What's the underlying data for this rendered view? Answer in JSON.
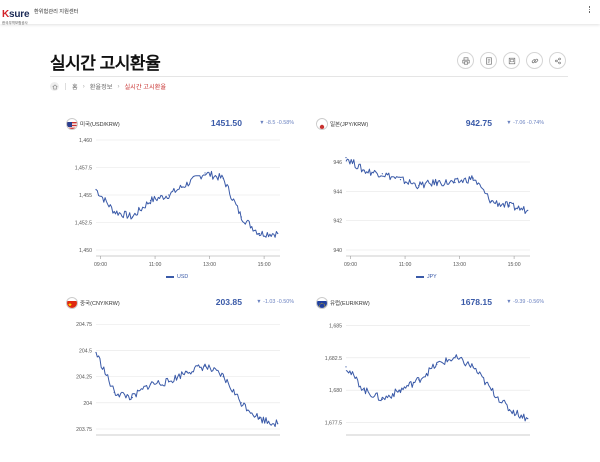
{
  "header": {
    "logo_text": "K sure",
    "logo_sub": "한국무역보험공사",
    "center_name": "환위험관리 지원센터"
  },
  "page": {
    "title": "실시간 고시환율",
    "breadcrumb": [
      "홈",
      "환율정보",
      "실시간 고시환율"
    ]
  },
  "toolbar": [
    "print-icon",
    "document-icon",
    "image-icon",
    "link-icon",
    "share-icon"
  ],
  "colors": {
    "accent": "#3a5aa8",
    "breadcrumb_current": "#c8312f"
  },
  "cards": [
    {
      "name": "미국",
      "code": "USD/KRW",
      "rate": "1451.50",
      "change": "▼ -8.5  -0.58%",
      "legend": "USD",
      "flag": "us"
    },
    {
      "name": "일본",
      "code": "JPY/KRW",
      "rate": "942.75",
      "change": "▼ -7.06  -0.74%",
      "legend": "JPY",
      "flag": "jp"
    },
    {
      "name": "중국",
      "code": "CNY/KRW",
      "rate": "203.85",
      "change": "▼ -1.03  -0.50%",
      "legend": "",
      "flag": "cn"
    },
    {
      "name": "유럽",
      "code": "EUR/KRW",
      "rate": "1678.15",
      "change": "▼ -9.39  -0.56%",
      "legend": "",
      "flag": "eu"
    }
  ],
  "chart_data": [
    {
      "type": "line",
      "series": [
        {
          "name": "USD",
          "x": [
            "08:50",
            "09:30",
            "10:10",
            "10:50",
            "11:30",
            "12:10",
            "12:50",
            "13:30",
            "14:10",
            "14:50",
            "15:30"
          ],
          "values": [
            1455.5,
            1453.5,
            1453.0,
            1454.5,
            1455.0,
            1456.0,
            1457.0,
            1456.5,
            1453.0,
            1451.5,
            1451.5
          ]
        }
      ],
      "yticks": [
        "1,450",
        "1,452.5",
        "1,455",
        "1,457.5",
        "1,460"
      ],
      "xticks": [
        "09:00",
        "11:00",
        "13:00",
        "15:00"
      ],
      "ylim": [
        1450,
        1460
      ]
    },
    {
      "type": "line",
      "series": [
        {
          "name": "JPY",
          "x": [
            "08:50",
            "09:30",
            "10:10",
            "10:50",
            "11:30",
            "12:10",
            "12:50",
            "13:30",
            "14:10",
            "14:50",
            "15:30"
          ],
          "values": [
            946.3,
            945.4,
            945.2,
            944.8,
            944.4,
            944.6,
            944.6,
            944.9,
            943.3,
            943.0,
            942.7
          ]
        }
      ],
      "yticks": [
        "940",
        "942",
        "944",
        "946"
      ],
      "xticks": [
        "09:00",
        "11:00",
        "13:00",
        "15:00"
      ],
      "ylim": [
        940,
        947.5
      ]
    },
    {
      "type": "line",
      "series": [
        {
          "name": "CNY",
          "x": [
            "08:50",
            "09:30",
            "10:10",
            "10:50",
            "11:30",
            "12:10",
            "12:50",
            "13:30",
            "14:10",
            "14:50",
            "15:30"
          ],
          "values": [
            204.48,
            204.1,
            204.05,
            204.18,
            204.2,
            204.3,
            204.35,
            204.25,
            204.0,
            203.85,
            203.8
          ]
        }
      ],
      "yticks": [
        "203.75",
        "204",
        "204.25",
        "204.5",
        "204.75"
      ],
      "ylim": [
        203.75,
        204.8
      ]
    },
    {
      "type": "line",
      "series": [
        {
          "name": "EUR",
          "x": [
            "08:50",
            "09:30",
            "10:10",
            "10:50",
            "11:30",
            "12:10",
            "12:50",
            "13:30",
            "14:10",
            "14:50",
            "15:30"
          ],
          "values": [
            1681.8,
            1680.0,
            1679.3,
            1680.0,
            1680.8,
            1682.0,
            1682.5,
            1681.8,
            1680.0,
            1678.5,
            1677.8
          ]
        }
      ],
      "yticks": [
        "1,677.5",
        "1,680",
        "1,682.5",
        "1,685"
      ],
      "ylim": [
        1677,
        1685.5
      ]
    }
  ]
}
